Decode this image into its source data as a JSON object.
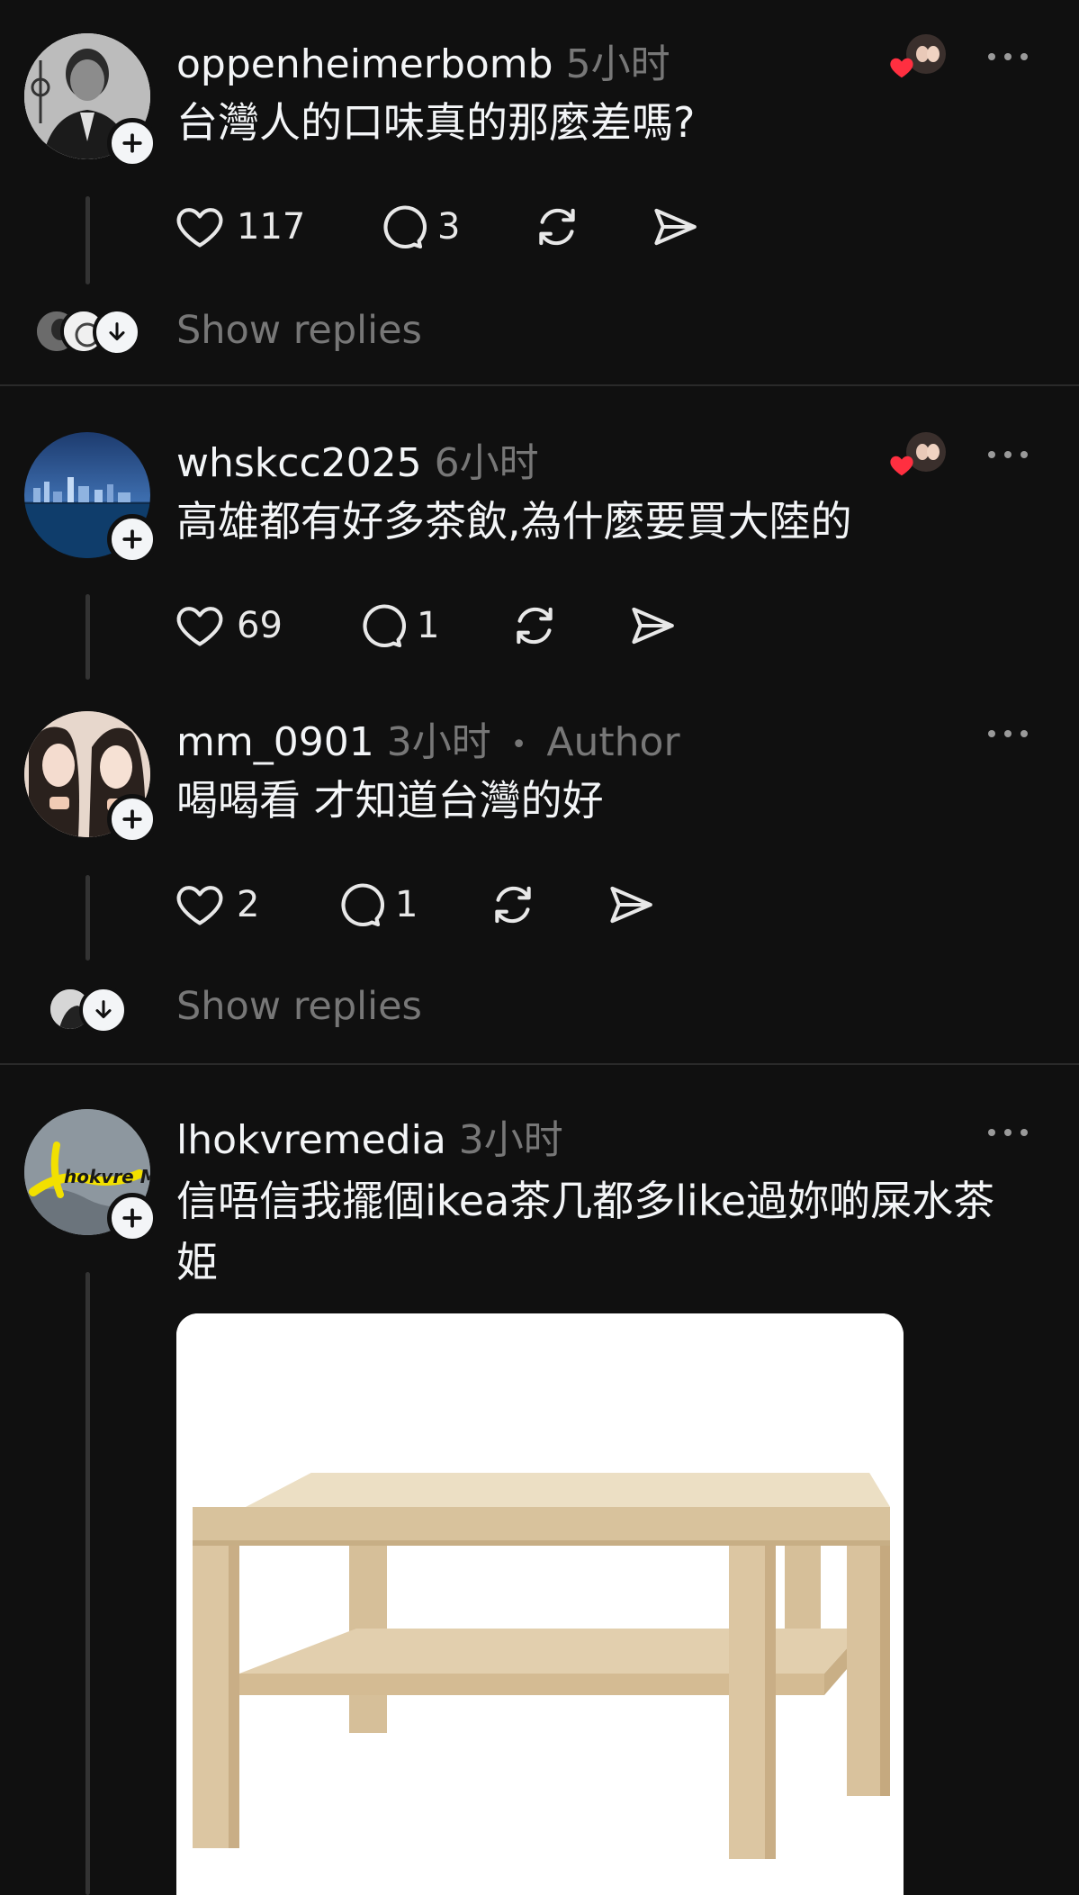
{
  "posts": [
    {
      "username": "oppenheimerbomb",
      "time": "5小时",
      "text": "台灣人的口味真的那麼差嗎?",
      "likes": "117",
      "replies": "3",
      "show_replies": "Show replies"
    },
    {
      "username": "whskcc2025",
      "time": "6小时",
      "text": "高雄都有好多茶飲,為什麼要買大陸的",
      "likes": "69",
      "replies": "1"
    },
    {
      "username": "mm_0901",
      "time": "3小时",
      "author_tag": "Author",
      "separator": "•",
      "text": "喝喝看 才知道台灣的好",
      "likes": "2",
      "replies": "1",
      "show_replies": "Show replies"
    },
    {
      "username": "lhokvremedia",
      "time": "3小时",
      "text": "信唔信我擺個ikea茶几都多like過妳啲屎水茶姫",
      "avatar_logo_text": "hokvre Media"
    }
  ],
  "icons": {
    "like": "heart-icon",
    "reply": "comment-icon",
    "repost": "repost-icon",
    "share": "send-icon",
    "more": "more-icon",
    "follow": "plus-icon",
    "expand": "arrow-down-icon"
  },
  "colors": {
    "background": "#101010",
    "text": "#f3f5f7",
    "muted": "#777777",
    "like_heart": "#ff2f40"
  }
}
